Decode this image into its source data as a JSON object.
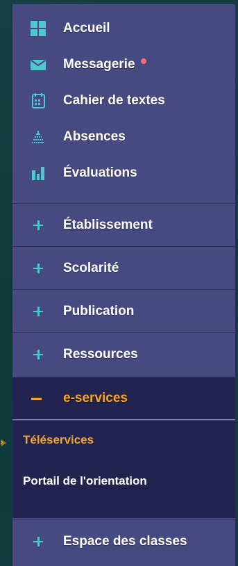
{
  "menu": {
    "items": [
      {
        "label": "Accueil",
        "icon": "grid-icon"
      },
      {
        "label": "Messagerie",
        "icon": "envelope-icon",
        "badge_color": "#ee6e73"
      },
      {
        "label": "Cahier de textes",
        "icon": "calendar-icon"
      },
      {
        "label": "Absences",
        "icon": "absences-icon"
      },
      {
        "label": "Évaluations",
        "icon": "bar-chart-icon"
      }
    ],
    "sections": [
      {
        "label": "Établissement",
        "state": "collapsed"
      },
      {
        "label": "Scolarité",
        "state": "collapsed"
      },
      {
        "label": "Publication",
        "state": "collapsed"
      },
      {
        "label": "Ressources",
        "state": "collapsed"
      },
      {
        "label": "e-services",
        "state": "expanded"
      },
      {
        "label": "Espace des classes",
        "state": "collapsed"
      }
    ],
    "eservices_items": [
      {
        "label": "Téléservices",
        "active": true
      },
      {
        "label": "Portail de l'orientation",
        "active": false
      }
    ]
  },
  "colors": {
    "panel": "#474a80",
    "active_section": "#23234f",
    "accent_orange": "#f5a623",
    "accent_cyan": "#4fc7d2"
  }
}
